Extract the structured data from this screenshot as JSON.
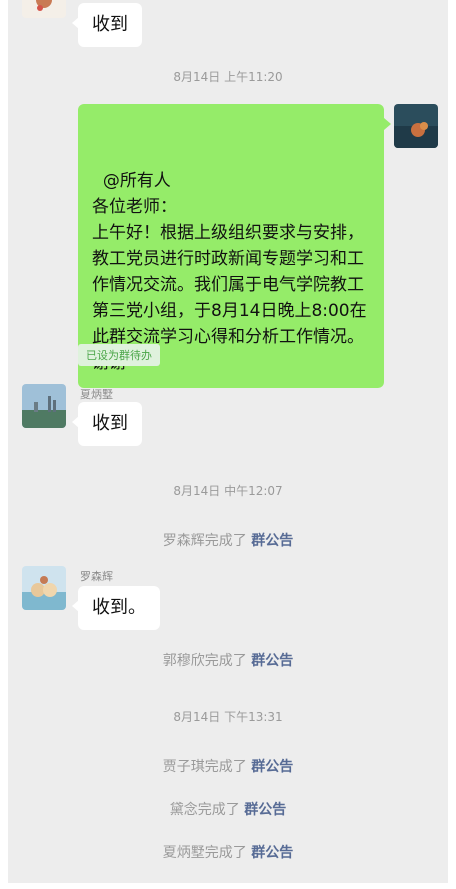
{
  "messages": {
    "m0": {
      "text": "收到"
    },
    "m1": {
      "text": "@所有人\n各位老师：\n上午好！根据上级组织要求与安排，教工党员进行时政新闻专题学习和工作情况交流。我们属于电气学院教工第三党小组，于8月14日晚上8:00在此群交流学习心得和分析工作情况。谢谢",
      "tag": "已设为群待办"
    },
    "m2": {
      "sender": "夏炳墅",
      "text": "收到"
    },
    "m3": {
      "sender": "罗森辉",
      "text": "收到。"
    }
  },
  "timestamps": {
    "t1": "8月14日 上午11:20",
    "t2": "8月14日 中午12:07",
    "t3": "8月14日 下午13:31"
  },
  "system": {
    "link_label": "群公告",
    "s1": "罗森辉完成了",
    "s2": "郭穆欣完成了",
    "s3": "贾子琪完成了",
    "s4": "黛念完成了",
    "s5": "夏炳墅完成了"
  },
  "colors": {
    "background": "#ededed",
    "self_bubble": "#95ec69",
    "other_bubble": "#ffffff",
    "link": "#576b95"
  }
}
